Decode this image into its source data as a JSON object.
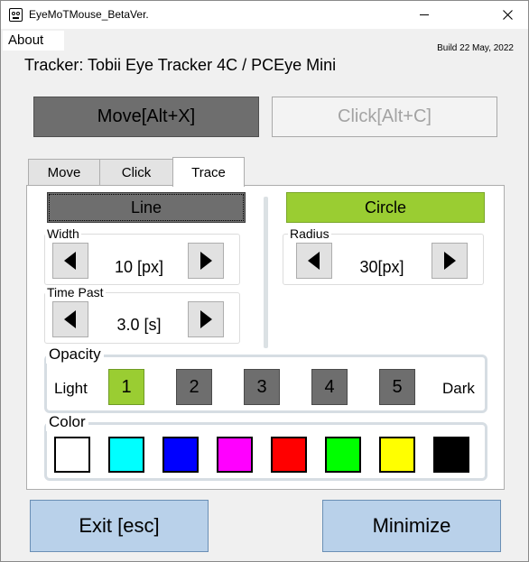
{
  "window": {
    "title": "EyeMoTMouse_BetaVer."
  },
  "menu": {
    "about_label": "About"
  },
  "header": {
    "build": "Build 22 May, 2022",
    "tracker": "Tracker: Tobii Eye Tracker 4C / PCEye Mini"
  },
  "modes": {
    "move_label": "Move[Alt+X]",
    "click_label": "Click[Alt+C]"
  },
  "tabs": [
    {
      "label": "Move"
    },
    {
      "label": "Click"
    },
    {
      "label": "Trace",
      "active": true
    }
  ],
  "trace": {
    "line_label": "Line",
    "circle_label": "Circle",
    "width": {
      "label": "Width",
      "value": "10 [px]"
    },
    "time_past": {
      "label": "Time Past",
      "value": "3.0 [s]"
    },
    "radius": {
      "label": "Radius",
      "value": "30[px]"
    },
    "opacity": {
      "label": "Opacity",
      "light_label": "Light",
      "dark_label": "Dark",
      "levels": [
        "1",
        "2",
        "3",
        "4",
        "5"
      ],
      "selected": "1"
    },
    "color": {
      "label": "Color",
      "swatches": [
        "#ffffff",
        "#00ffff",
        "#0000ff",
        "#ff00ff",
        "#ff0000",
        "#00ff00",
        "#ffff00",
        "#000000"
      ]
    }
  },
  "footer": {
    "exit_label": "Exit [esc]",
    "minimize_label": "Minimize"
  },
  "colors": {
    "selected_green": "#9acd32",
    "dark_gray": "#6e6e6e",
    "footer_blue": "#b9d1ea"
  }
}
